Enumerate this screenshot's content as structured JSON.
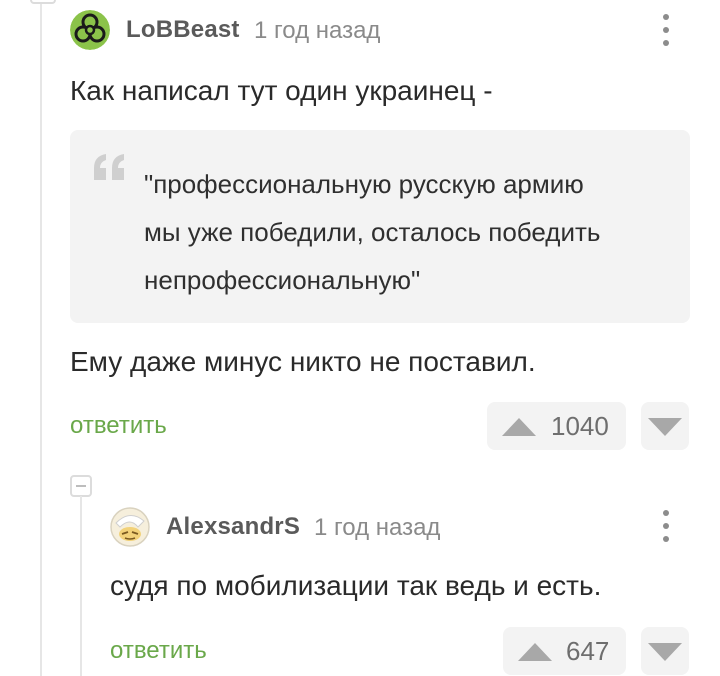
{
  "comment": {
    "author": "LoBBeast",
    "time": "1 год назад",
    "text_before": "Как написал тут один украинец -",
    "quote": "\"профессиональную русскую армию\nмы уже победили, осталось победить\nнепрофессиональную\"",
    "text_after": "Ему даже минус никто не поставил.",
    "reply_label": "ответить",
    "rating": "1040",
    "avatar_icon": "biohazard-icon",
    "more_icon": "more-vertical-icon"
  },
  "reply": {
    "author": "AlexsandrS",
    "time": "1 год назад",
    "text": "судя по мобилизации так ведь и есть.",
    "reply_label": "ответить",
    "rating": "647",
    "avatar_icon": "cartoon-face-icon",
    "more_icon": "more-vertical-icon"
  },
  "colors": {
    "reply_link": "#6aa84a",
    "avatar_green": "#8bc34a",
    "vote_bg": "#f3f3f3"
  }
}
